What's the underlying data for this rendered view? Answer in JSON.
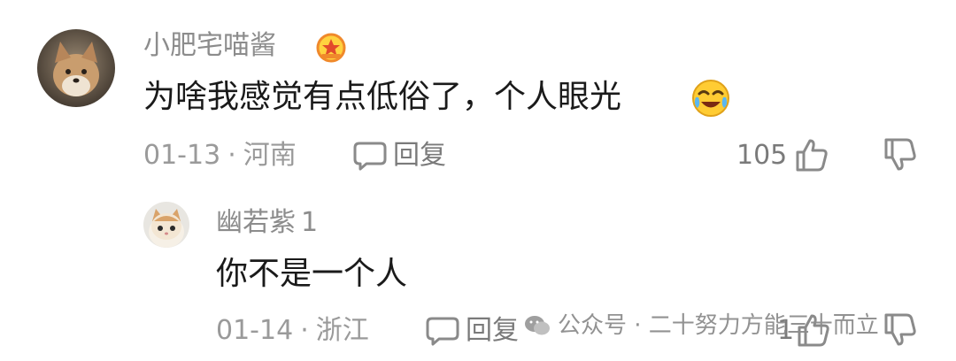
{
  "comment": {
    "username": "小肥宅喵酱",
    "badge_icon": "star-medal-icon",
    "text": "为啥我感觉有点低俗了，个人眼光",
    "emoji_icon": "laughing-crying-emoji-icon",
    "date": "01-13",
    "separator": "·",
    "location": "河南",
    "reply_label": "回复",
    "like_count": "105"
  },
  "reply": {
    "username": "幽若紫",
    "username_suffix": "1",
    "text": "你不是一个人",
    "date": "01-14",
    "separator": "·",
    "location": "浙江",
    "reply_label": "回复",
    "like_count": "1"
  },
  "watermark": {
    "text": "公众号 · 二十努力方能三十而立"
  },
  "colors": {
    "username": "#8c8c8c",
    "text": "#1a1a1a",
    "meta": "#9a9a9a",
    "badge_orange": "#f0892b",
    "badge_yellow": "#ffd23f"
  }
}
